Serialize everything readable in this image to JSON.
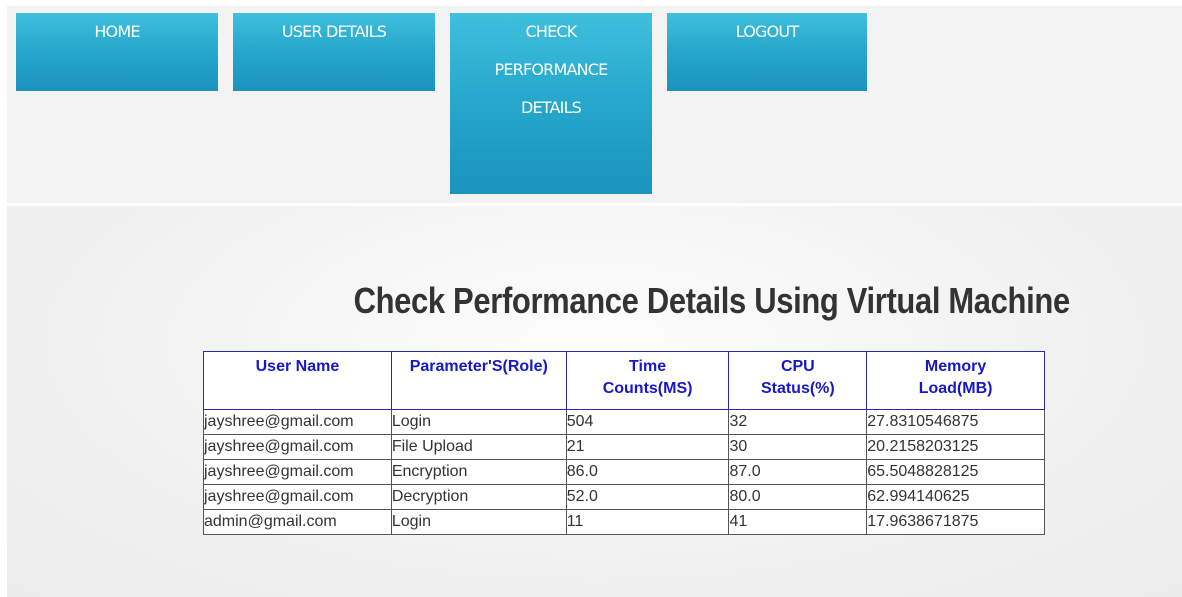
{
  "nav": {
    "home": "HOME",
    "user_details": "USER DETAILS",
    "check_performance": [
      "CHECK",
      "PERFORMANCE",
      "DETAILS"
    ],
    "logout": "LOGOUT"
  },
  "page_title": "Check Performance Details Using Virtual Machine",
  "table": {
    "headers": {
      "user_name": "User Name",
      "parameter": "Parameter'S(Role)",
      "time": [
        "Time",
        "Counts(MS)"
      ],
      "cpu": [
        "CPU",
        "Status(%)"
      ],
      "memory": [
        "Memory",
        "Load(MB)"
      ]
    },
    "rows": [
      [
        "jayshree@gmail.com",
        "Login",
        "504",
        "32",
        "27.8310546875"
      ],
      [
        "jayshree@gmail.com",
        "File Upload",
        "21",
        "30",
        "20.2158203125"
      ],
      [
        "jayshree@gmail.com",
        "Encryption",
        "86.0",
        "87.0",
        "65.5048828125"
      ],
      [
        "jayshree@gmail.com",
        "Decryption",
        "52.0",
        "80.0",
        "62.994140625"
      ],
      [
        "admin@gmail.com",
        "Login",
        "11",
        "41",
        "17.9638671875"
      ]
    ]
  },
  "colors": {
    "nav_button_top": "#3fc0dd",
    "nav_button_bottom": "#1a93be",
    "table_header_text": "#1717c9",
    "table_header_border": "#2a2aa8"
  }
}
